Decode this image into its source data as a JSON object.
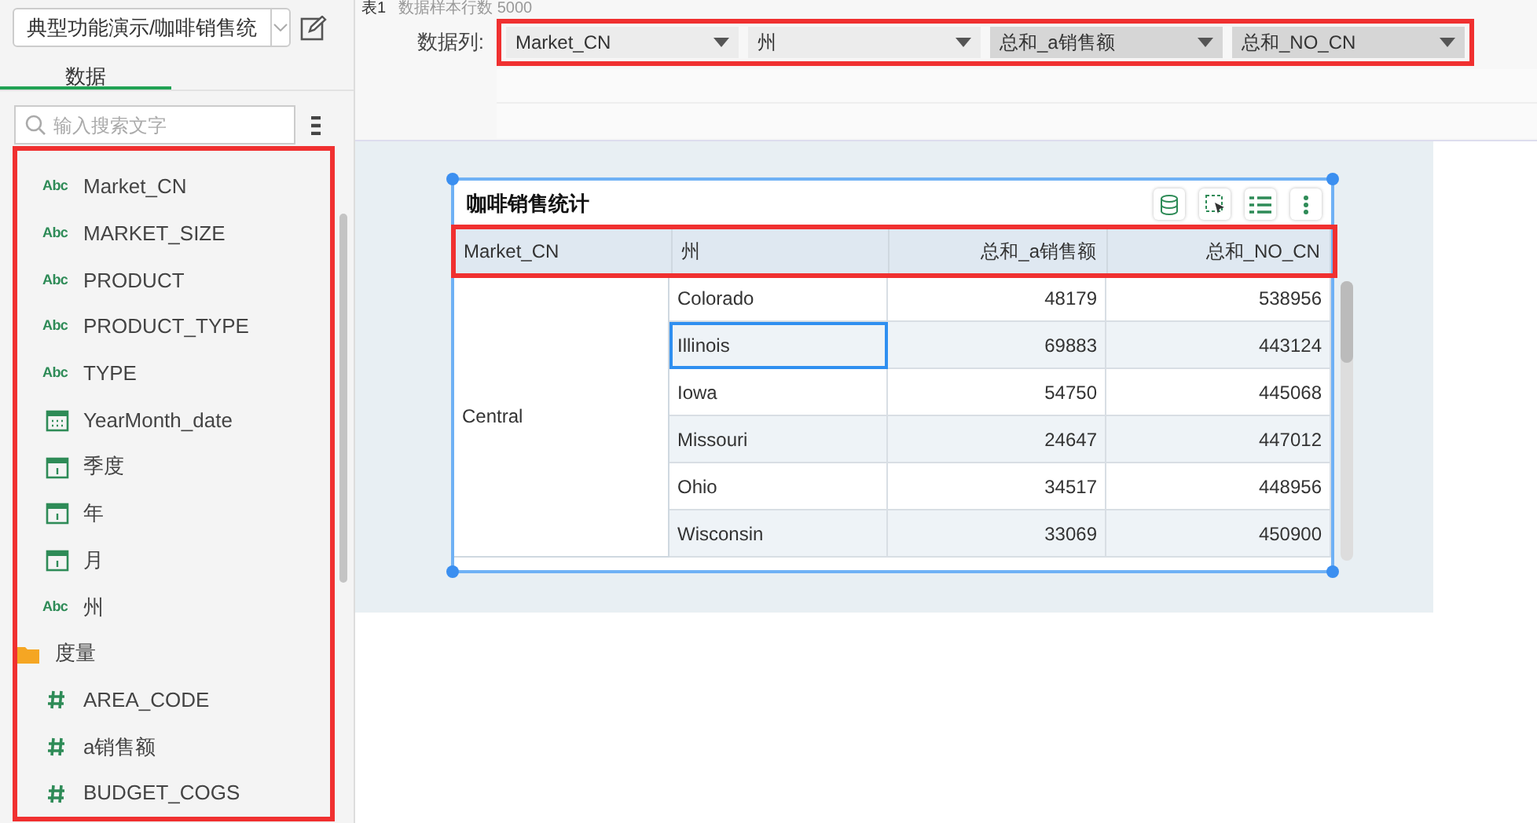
{
  "top_strip": {
    "title": "表1",
    "info": "数据样本行数 5000"
  },
  "sidebar": {
    "dataset": "典型功能演示/咖啡销售统",
    "tabs": [
      {
        "label": "数据",
        "selected": true
      }
    ],
    "search": {
      "placeholder": "输入搜索文字"
    },
    "items": [
      {
        "kind": "text",
        "icon_text": "Abc",
        "label": "Market_CN"
      },
      {
        "kind": "text",
        "icon_text": "Abc",
        "label": "MARKET_SIZE"
      },
      {
        "kind": "text",
        "icon_text": "Abc",
        "label": "PRODUCT"
      },
      {
        "kind": "text",
        "icon_text": "Abc",
        "label": "PRODUCT_TYPE"
      },
      {
        "kind": "text",
        "icon_text": "Abc",
        "label": "TYPE"
      },
      {
        "kind": "datetime",
        "label": "YearMonth_date"
      },
      {
        "kind": "date",
        "label": "季度"
      },
      {
        "kind": "date",
        "label": "年"
      },
      {
        "kind": "date",
        "label": "月"
      },
      {
        "kind": "text",
        "icon_text": "Abc",
        "label": "州"
      },
      {
        "kind": "folder",
        "label": "度量"
      },
      {
        "kind": "number",
        "label": "AREA_CODE"
      },
      {
        "kind": "number",
        "label": "a销售额"
      },
      {
        "kind": "number",
        "label": "BUDGET_COGS"
      }
    ]
  },
  "config": {
    "label": "数据列:",
    "columns": [
      {
        "kind": "dimension",
        "label": "Market_CN"
      },
      {
        "kind": "dimension",
        "label": "州"
      },
      {
        "kind": "measure",
        "label": "总和_a销售额"
      },
      {
        "kind": "measure",
        "label": "总和_NO_CN"
      }
    ]
  },
  "widget": {
    "title": "咖啡销售统计",
    "table": {
      "columns": [
        {
          "label": "Market_CN",
          "kind": "dimension"
        },
        {
          "label": "州",
          "kind": "dimension"
        },
        {
          "label": "总和_a销售额",
          "kind": "measure"
        },
        {
          "label": "总和_NO_CN",
          "kind": "measure"
        }
      ],
      "groups": [
        {
          "label": "Central",
          "rows": [
            {
              "cells": [
                "Colorado",
                "48179",
                "538956"
              ],
              "selected": false
            },
            {
              "cells": [
                "Illinois",
                "69883",
                "443124"
              ],
              "selected": true
            },
            {
              "cells": [
                "Iowa",
                "54750",
                "445068"
              ],
              "selected": false
            },
            {
              "cells": [
                "Missouri",
                "24647",
                "447012"
              ],
              "selected": false
            },
            {
              "cells": [
                "Ohio",
                "34517",
                "448956"
              ],
              "selected": false
            },
            {
              "cells": [
                "Wisconsin",
                "33069",
                "450900"
              ],
              "selected": false
            }
          ]
        }
      ]
    }
  }
}
